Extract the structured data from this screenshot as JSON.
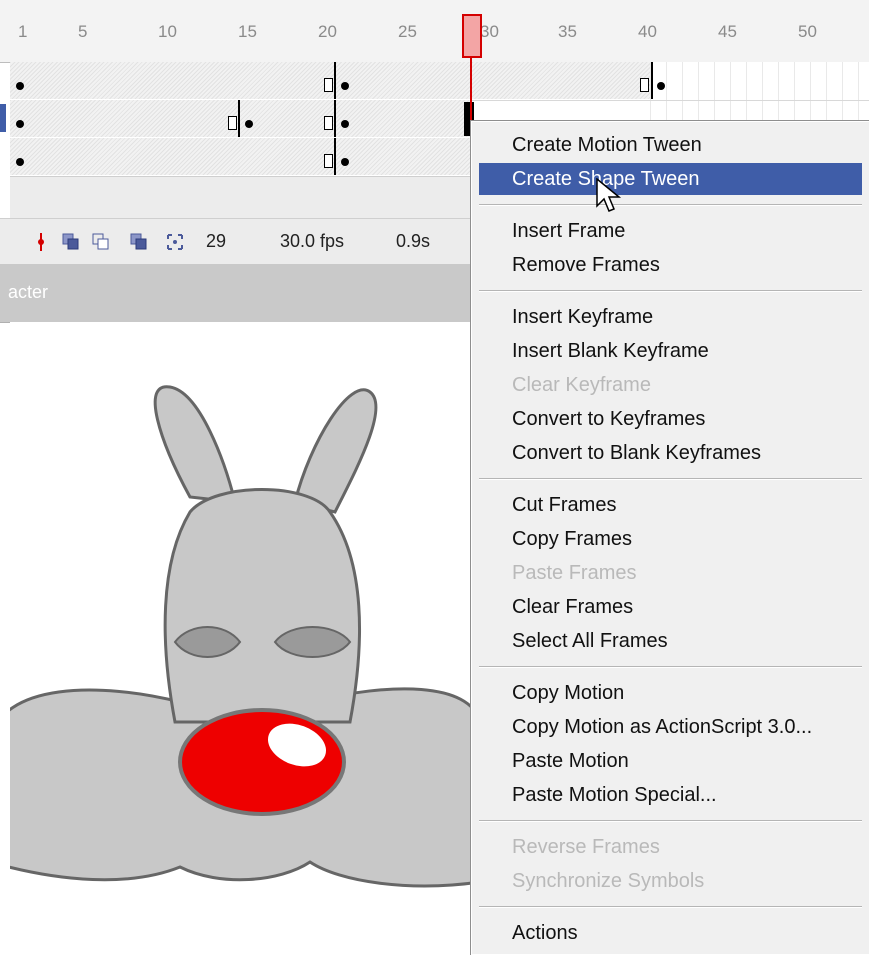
{
  "ruler": {
    "ticks": [
      "1",
      "5",
      "10",
      "15",
      "20",
      "25",
      "30",
      "35",
      "40",
      "45",
      "50"
    ],
    "playhead_frame": "29"
  },
  "statusbar": {
    "current_frame": "29",
    "fps": "30.0 fps",
    "elapsed": "0.9s"
  },
  "panel": {
    "character_label": "acter"
  },
  "menu": {
    "create_motion_tween": "Create Motion Tween",
    "create_shape_tween": "Create Shape Tween",
    "insert_frame": "Insert Frame",
    "remove_frames": "Remove Frames",
    "insert_keyframe": "Insert Keyframe",
    "insert_blank_keyframe": "Insert Blank Keyframe",
    "clear_keyframe": "Clear Keyframe",
    "convert_to_keyframes": "Convert to Keyframes",
    "convert_to_blank_keyframes": "Convert to Blank Keyframes",
    "cut_frames": "Cut Frames",
    "copy_frames": "Copy Frames",
    "paste_frames": "Paste Frames",
    "clear_frames": "Clear Frames",
    "select_all_frames": "Select All Frames",
    "copy_motion": "Copy Motion",
    "copy_motion_as3": "Copy Motion as ActionScript 3.0...",
    "paste_motion": "Paste Motion",
    "paste_motion_special": "Paste Motion Special...",
    "reverse_frames": "Reverse Frames",
    "synchronize_symbols": "Synchronize Symbols",
    "actions": "Actions"
  },
  "colors": {
    "menu_highlight": "#3f5da8",
    "playhead": "#d40000",
    "nose": "#ee0000",
    "body": "#c8c8c8",
    "outline": "#666666"
  },
  "icons": [
    "onion-skin-icon",
    "onion-outline-icon",
    "edit-multiple-icon",
    "modify-markers-icon",
    "center-frame-icon"
  ]
}
